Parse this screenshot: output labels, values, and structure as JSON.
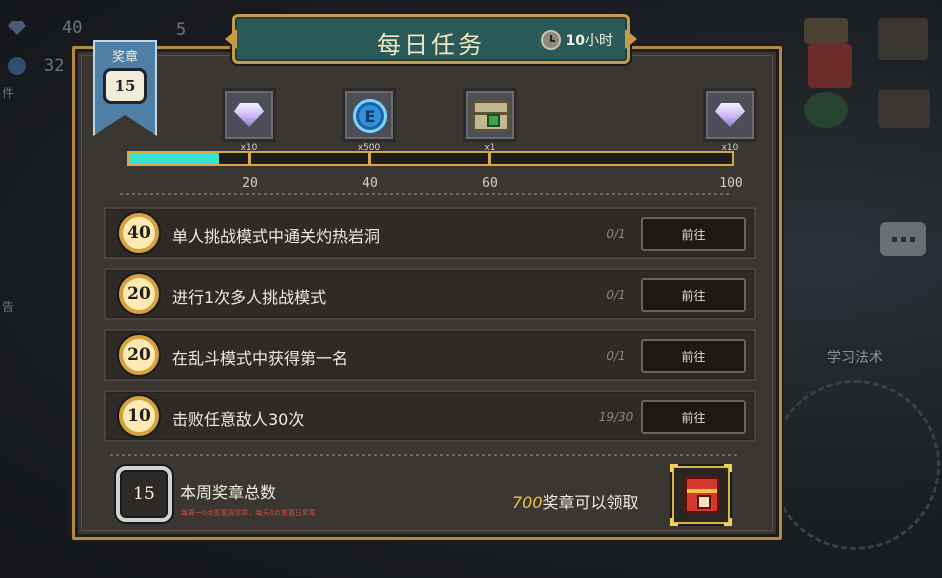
{
  "title": "每日任务",
  "timer": {
    "number": "10",
    "unit": "小时"
  },
  "medal": {
    "label": "奖章",
    "count": "15"
  },
  "rewards": [
    {
      "icon": "diamond-icon",
      "count": "x10"
    },
    {
      "icon": "e-coin-icon",
      "count": "x500",
      "glyph": "E"
    },
    {
      "icon": "chest-icon",
      "count": "x1"
    },
    {
      "icon": "diamond-icon",
      "count": "x10"
    }
  ],
  "progress": {
    "value": 15,
    "max": 100,
    "milestones": [
      "20",
      "40",
      "60",
      "100"
    ]
  },
  "tasks": [
    {
      "points": "40",
      "text": "单人挑战模式中通关灼热岩洞",
      "progress": "0/1",
      "button": "前往"
    },
    {
      "points": "20",
      "text": "进行1次多人挑战模式",
      "progress": "0/1",
      "button": "前往"
    },
    {
      "points": "20",
      "text": "在乱斗模式中获得第一名",
      "progress": "0/1",
      "button": "前往"
    },
    {
      "points": "10",
      "text": "击败任意敌人30次",
      "progress": "19/30",
      "button": "前往"
    }
  ],
  "summary": {
    "count": "15",
    "title": "本周奖章总数",
    "note": "每周一0点重置周奖章，每天0点重置日奖章",
    "claim_number": "700",
    "claim_text": "奖章可以领取"
  },
  "background": {
    "stat_1": "40",
    "stat_2": "5",
    "stat_3": "32",
    "side_1": "件",
    "side_2": "告",
    "learn": "学习法术"
  },
  "colors": {
    "accent_gold": "#d6a64a",
    "progress_fill": "#35e4cf",
    "banner_teal": "#2a5a58",
    "ribbon_blue": "#4f7fa4"
  }
}
